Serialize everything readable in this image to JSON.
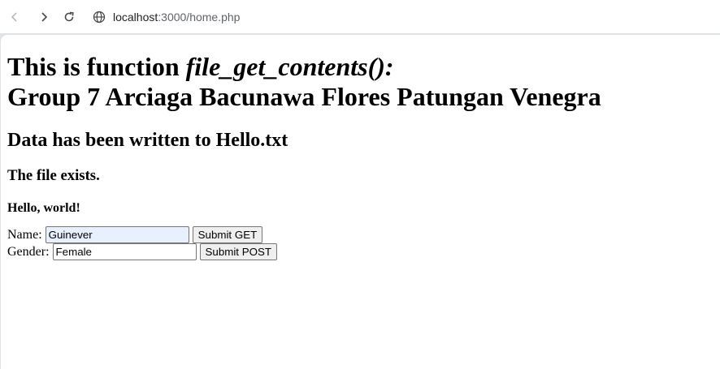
{
  "browser": {
    "url_host": "localhost",
    "url_rest": ":3000/home.php",
    "icons": {
      "back": "arrow-left-icon",
      "forward": "arrow-right-icon",
      "reload": "reload-icon",
      "site_info": "globe-icon"
    }
  },
  "page": {
    "heading_line1_plain": "This is function ",
    "heading_line1_italic": "file_get_contents():",
    "heading_line2": "Group 7 Arciaga Bacunawa Flores Patungan Venegra",
    "write_status": "Data has been written to Hello.txt",
    "exists_status": "The file exists.",
    "file_content": "Hello, world!"
  },
  "form": {
    "name_label": "Name:",
    "name_value": "Guinever",
    "get_button": "Submit GET",
    "gender_label": "Gender:",
    "gender_value": "Female",
    "post_button": "Submit POST"
  }
}
